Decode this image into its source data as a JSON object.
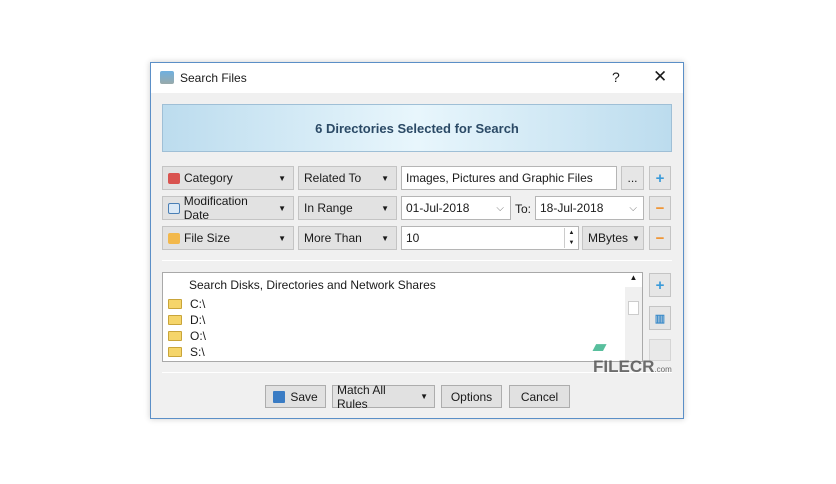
{
  "window": {
    "title": "Search Files",
    "help": "?",
    "close": "✕"
  },
  "banner": "6 Directories Selected for Search",
  "rules": [
    {
      "field": "Category",
      "condition": "Related To",
      "value": "Images, Pictures and Graphic Files",
      "browse": "...",
      "action": "+"
    },
    {
      "field": "Modification Date",
      "condition": "In Range",
      "from": "01-Jul-2018",
      "to_label": "To:",
      "to": "18-Jul-2018",
      "action": "−"
    },
    {
      "field": "File Size",
      "condition": "More Than",
      "value": "10",
      "unit": "MBytes",
      "action": "−"
    }
  ],
  "locations": {
    "header": "Search Disks, Directories and Network Shares",
    "items": [
      "C:\\",
      "D:\\",
      "O:\\",
      "S:\\"
    ]
  },
  "buttons": {
    "save": "Save",
    "match": "Match All Rules",
    "options": "Options",
    "cancel": "Cancel"
  },
  "watermark": {
    "text": "FILECR",
    ".com": ".com"
  }
}
